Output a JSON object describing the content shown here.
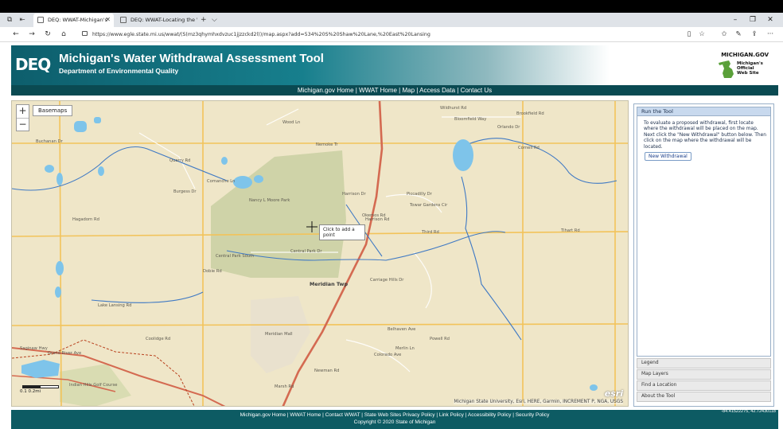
{
  "browser": {
    "tabs": [
      {
        "label": "DEQ: WWAT-Michigan's",
        "active": true
      },
      {
        "label": "DEQ: WWAT-Locating the W",
        "active": false
      }
    ],
    "new_tab": "+",
    "tab_menu": "⌵",
    "window_controls": {
      "minimize": "–",
      "restore": "❐",
      "close": "✕"
    },
    "url": "https://www.egle.state.mi.us/wwat/(S(mz3qhymhxdvzuc1jjzzckd2l))/map.aspx?add=534%20S%20Shaw%20Lane,%20East%20Lansing"
  },
  "header": {
    "logo_text": "DEQ",
    "title": "Michigan's Water Withdrawal Assessment Tool",
    "subtitle": "Department of Environmental Quality",
    "migov_title": "MICHIGAN.GOV",
    "migov_lines": [
      "Michigan's",
      "Official",
      "Web Site"
    ]
  },
  "nav": {
    "items": [
      "Michigan.gov Home",
      "WWAT Home",
      "Map",
      "Access Data",
      "Contact Us"
    ],
    "separator": " | "
  },
  "map": {
    "zoom_in": "+",
    "zoom_out": "−",
    "basemaps_label": "Basemaps",
    "tooltip_lines": [
      "Click to add a",
      "point"
    ],
    "attribution": "Michigan State University, Esri, HERE, Garmin, INCREMENT P, NGA, USGS",
    "esri_logo": "esri",
    "scale_label": "0.1      0.2mi",
    "labels": [
      "Wildhurst Rd",
      "Bloomfield Way",
      "Brookfield Rd",
      "Orlando Dr",
      "Wood Ln",
      "Buchanan Dr",
      "Quarry Rd",
      "Burgess Dr",
      "Nemoke Tr",
      "Comanche Ln",
      "Harrison Dr",
      "Nancy L Moore Park",
      "Harrison Rd",
      "Piccadilly Dr",
      "Towar Gardens Cir",
      "Tihart Rd",
      "Third Rd",
      "Central Park South",
      "Central Park Dr",
      "Meridian Twp",
      "Okemos Rd",
      "Marsh Rd",
      "Carriage Hills Dr",
      "Meridian Mall",
      "Merlin Ln",
      "Newman Rd",
      "Indian Hills Golf Course",
      "Grand River Ave",
      "Saginaw Hwy",
      "Lake Lansing Rd",
      "Dobie Rd",
      "Powell Rd",
      "Hagadorn Rd",
      "Coolidge Rd",
      "Colorado Ave",
      "Belhaven Ave",
      "Cornell Rd"
    ]
  },
  "panel": {
    "title": "Run the Tool",
    "instructions": "To evaluate a proposed withdrawal, first locate where the withdrawal will be placed on the map. Next click the \"New Withdrawal\" button below. Then click on the map where the withdrawal will be located.",
    "new_withdrawal_label": "New Withdrawal",
    "accordion": [
      "Legend",
      "Map Layers",
      "Find a Location",
      "About the Tool"
    ]
  },
  "footer": {
    "links": "Michigan.gov Home | WWAT Home | Contact WWAT | State Web Sites Privacy Policy | Link Policy | Accessibility Policy | Security Policy",
    "copyright": "Copyright © 2020 State of Michigan",
    "coords": "-84.41522275, 42.72430118"
  },
  "colors": {
    "banner_dark": "#0d5e6c",
    "navbar": "#0a4a52",
    "map_bg": "#efe6c8",
    "water": "#7ec4ea",
    "park": "#cfd3a8",
    "river": "#3f79c4",
    "highway": "#d46a51"
  }
}
